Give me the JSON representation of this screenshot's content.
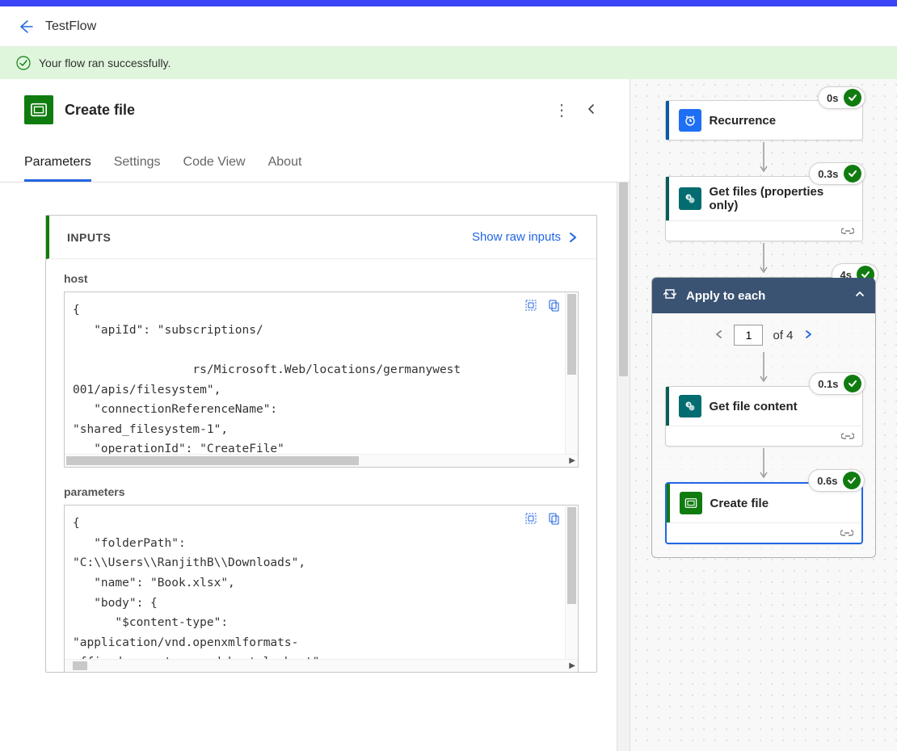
{
  "header": {
    "title": "TestFlow"
  },
  "flash": {
    "message": "Your flow ran successfully."
  },
  "left": {
    "step_title": "Create file",
    "tabs": {
      "parameters": "Parameters",
      "settings": "Settings",
      "codeview": "Code View",
      "about": "About"
    },
    "inputs_title": "INPUTS",
    "show_raw": "Show raw inputs",
    "blocks": {
      "host": {
        "label": "host",
        "code": "{\n   \"apiId\": \"subscriptions/\n\n                 rs/Microsoft.Web/locations/germanywest\n001/apis/filesystem\",\n   \"connectionReferenceName\": \n\"shared_filesystem-1\",\n   \"operationId\": \"CreateFile\"\n"
      },
      "parameters": {
        "label": "parameters",
        "code": "{\n   \"folderPath\": \n\"C:\\\\Users\\\\RanjithB\\\\Downloads\",\n   \"name\": \"Book.xlsx\",\n   \"body\": {\n      \"$content-type\": \n\"application/vnd.openxmlformats-\nofficedocument.spreadsheetml.sheet\",\n"
      }
    }
  },
  "right": {
    "nodes": {
      "recurrence": {
        "label": "Recurrence",
        "duration": "0s"
      },
      "get_files": {
        "label": "Get files (properties only)",
        "duration": "0.3s"
      },
      "apply_each": {
        "label": "Apply to each",
        "duration": "4s"
      },
      "get_content": {
        "label": "Get file content",
        "duration": "0.1s"
      },
      "create_file": {
        "label": "Create file",
        "duration": "0.6s"
      }
    },
    "pager": {
      "current": "1",
      "of_label": "of 4"
    }
  }
}
